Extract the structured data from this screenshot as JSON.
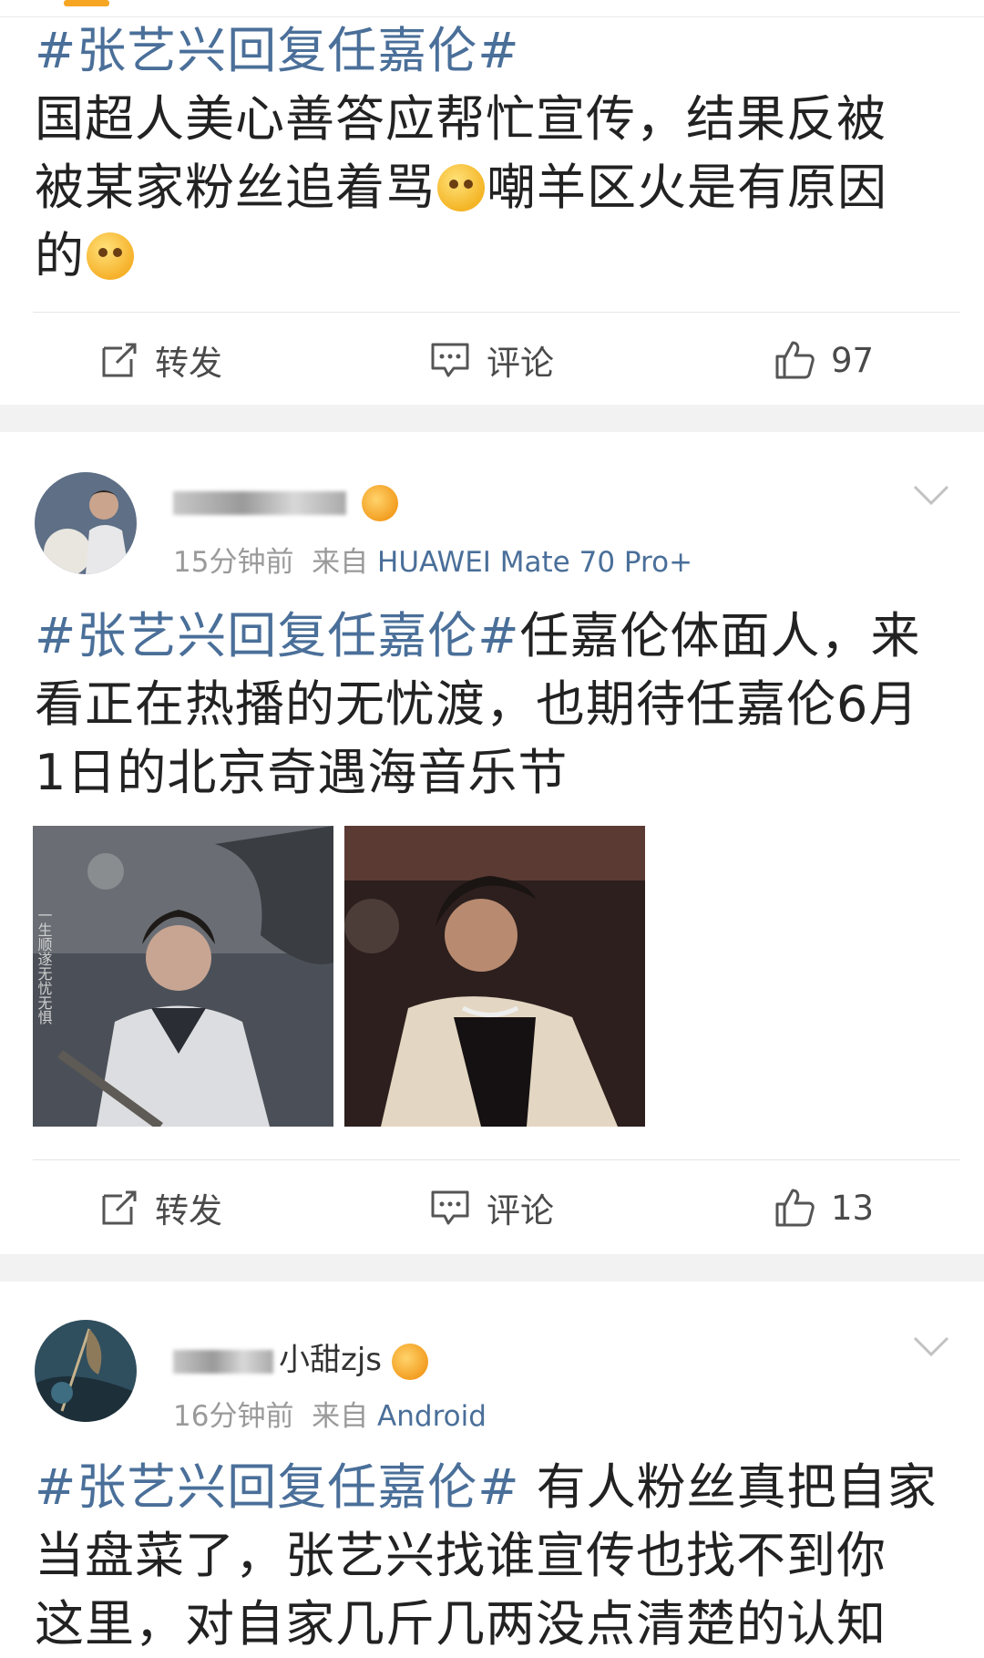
{
  "post1": {
    "hashtag": "#张艺兴回复任嘉伦#",
    "text_line1": "国超人美心善答应帮忙宣传，结果反被",
    "text_line2a": "被某家粉丝追着骂",
    "text_line2b": "嘲羊区火是有原因",
    "text_line3": "的",
    "actions": {
      "repost": "转发",
      "comment": "评论",
      "like": "97"
    }
  },
  "post2": {
    "username_visible": "",
    "time": "15分钟前",
    "from_label": "来自",
    "source": "HUAWEI Mate 70 Pro+",
    "hashtag": "#张艺兴回复任嘉伦#",
    "text_a": "任嘉伦体面人，来",
    "text_line2": "看正在热播的无忧渡，也期待任嘉伦6月",
    "text_line3": "1日的北京奇遇海音乐节",
    "actions": {
      "repost": "转发",
      "comment": "评论",
      "like": "13"
    }
  },
  "post3": {
    "username_visible": "小甜zjs",
    "time": "16分钟前",
    "from_label": "来自",
    "source": "Android",
    "hashtag": "#张艺兴回复任嘉伦#",
    "text_a": " 有人粉丝真把自家",
    "text_line2": "当盘菜了，张艺兴找谁宣传也找不到你",
    "text_line3": "这里，对自家几斤几两没点清楚的认知"
  },
  "colors": {
    "hashtag": "#4a6f99",
    "separator": "#f2f2f2",
    "meta": "#9a9a9a"
  },
  "icons": [
    "repost-icon",
    "comment-icon",
    "like-icon",
    "chevron-down-icon"
  ]
}
